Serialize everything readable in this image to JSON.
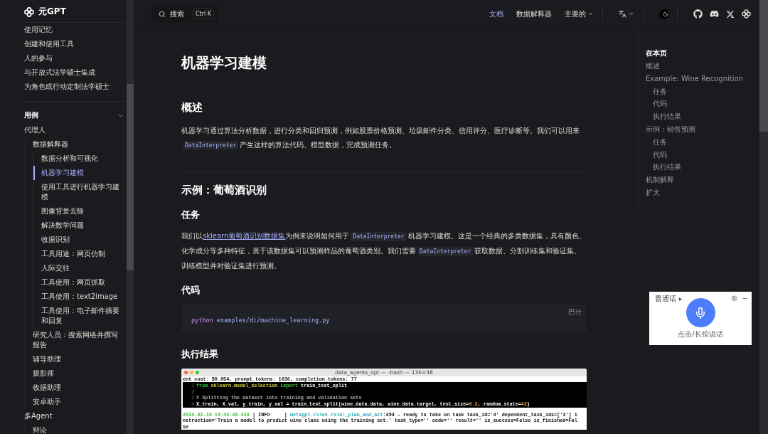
{
  "sidebar": {
    "logo_text": "元GPT",
    "items": [
      {
        "label": "使用记忆",
        "selected": false
      },
      {
        "label": "创建和使用工具",
        "selected": false
      },
      {
        "label": "人的参与",
        "selected": false
      },
      {
        "label": "与开放式法学硕士集成",
        "selected": false
      },
      {
        "label": "为角色或行动定制法学硕士",
        "selected": false
      }
    ],
    "sections": [
      {
        "title": "用例",
        "expanded": true,
        "children": [
          {
            "label": "代理人",
            "selected": false,
            "children": [
              {
                "label": "数据解释器",
                "selected": false,
                "children": [
                  {
                    "label": "数据分析和可视化",
                    "selected": false
                  },
                  {
                    "label": "机器学习建模",
                    "selected": true
                  },
                  {
                    "label": "使用工具进行机器学习建模",
                    "selected": false
                  },
                  {
                    "label": "图像背景去除",
                    "selected": false
                  },
                  {
                    "label": "解决数学问题",
                    "selected": false
                  },
                  {
                    "label": "收据识别",
                    "selected": false
                  },
                  {
                    "label": "工具用途：网页仿制",
                    "selected": false
                  },
                  {
                    "label": "人际交往",
                    "selected": false
                  },
                  {
                    "label": "工具使用：网页抓取",
                    "selected": false
                  },
                  {
                    "label": "工具使用：text2image",
                    "selected": false
                  },
                  {
                    "label": "工具使用：电子邮件摘要和回复",
                    "selected": false
                  }
                ]
              },
              {
                "label": "研究人员：搜索网络并撰写报告",
                "selected": false
              },
              {
                "label": "辅导助理",
                "selected": false
              },
              {
                "label": "摄影师",
                "selected": false
              },
              {
                "label": "收据助理",
                "selected": false
              },
              {
                "label": "安卓助手",
                "selected": false
              }
            ]
          },
          {
            "label": "多Agent",
            "selected": false,
            "children": [
              {
                "label": "辩论",
                "selected": false
              }
            ]
          }
        ]
      }
    ]
  },
  "topbar": {
    "search": {
      "placeholder": "搜索",
      "shortcut": "Ctrl K"
    },
    "nav": [
      {
        "label": "文档",
        "selected": true,
        "dropdown": false
      },
      {
        "label": "数据解释器",
        "selected": false,
        "dropdown": false
      },
      {
        "label": "主要的",
        "selected": false,
        "dropdown": true
      }
    ]
  },
  "article": {
    "title": "机器学习建模",
    "blocks": [
      {
        "kind": "h2",
        "text": "概述"
      },
      {
        "kind": "paragraph",
        "segments": [
          {
            "kind": "text",
            "text": "机器学习通过算法分析数据，进行分类和回归预测，例如股票价格预测、垃圾邮件分类、信用评分、医疗诊断等。我们可以用来"
          },
          {
            "kind": "code",
            "text": "DataInterpreter"
          },
          {
            "kind": "text",
            "text": "产生这样的算法代码、模型数据，完成预测任务。"
          }
        ]
      },
      {
        "kind": "rule"
      },
      {
        "kind": "h2",
        "text": "示例：葡萄酒识别"
      },
      {
        "kind": "h3",
        "text": "任务"
      },
      {
        "kind": "paragraph",
        "segments": [
          {
            "kind": "text",
            "text": "我们以"
          },
          {
            "kind": "link",
            "text": "sklearn葡萄酒识别数据集"
          },
          {
            "kind": "text",
            "text": "为例来说明如何用于"
          },
          {
            "kind": "code",
            "text": "DataInterpreter"
          },
          {
            "kind": "text",
            "text": "机器学习建模。这是一个经典的多类数据集，具有颜色、化学成分等多种特征，基于该数据集可以预测样品的葡萄酒类别。我们需要"
          },
          {
            "kind": "code",
            "text": "DataInterpreter"
          },
          {
            "kind": "text",
            "text": "获取数据、分割训练集和验证集、训练模型并对验证集进行预测。"
          }
        ]
      },
      {
        "kind": "h3",
        "text": "代码"
      },
      {
        "kind": "codeblock",
        "language": "巴什",
        "segments": [
          {
            "kind": "command",
            "text": "python"
          },
          {
            "kind": "plain",
            "text": " examples/di/machine_learning.py"
          }
        ]
      },
      {
        "kind": "h3",
        "text": "执行结果"
      },
      {
        "kind": "terminal",
        "title": "data_agents_opt — -bash — 136×38",
        "header": "ent cost: $0.054, prompt_tokens: 1636, completion_tokens: 77",
        "code_lines": [
          {
            "number": "1",
            "segments": [
              {
                "kind": "keyword",
                "text": "from"
              },
              {
                "kind": "module",
                "text": " sklearn.model_selection "
              },
              {
                "kind": "keyword",
                "text": "import"
              },
              {
                "kind": "plain",
                "text": " train_test_split"
              }
            ]
          },
          {
            "number": "2"
          },
          {
            "number": "3",
            "segments": [
              {
                "kind": "comment",
                "text": "# Splitting the dataset into training and validation sets"
              }
            ]
          },
          {
            "number": "4",
            "segments": [
              {
                "kind": "plain",
                "text": "X_train, X_val, y_train, y_val = train_test_split(wine_data.data, wine_data.target, test_size="
              },
              {
                "kind": "number",
                "text": "0.2"
              },
              {
                "kind": "plain",
                "text": ", random_state="
              },
              {
                "kind": "number",
                "text": "42"
              },
              {
                "kind": "plain",
                "text": ")"
              }
            ]
          }
        ],
        "log_lines": [
          {
            "segments": [
              {
                "kind": "time",
                "text": "2024-02-19 19:46:38.423"
              },
              {
                "kind": "plain",
                "text": " | INFO     | "
              },
              {
                "kind": "module",
                "text": "metagpt.roles.role"
              },
              {
                "kind": "plain",
                "text": ":"
              },
              {
                "kind": "module",
                "text": "_plan_and_act"
              },
              {
                "kind": "plain",
                "text": ":494 - ready to take on task task_id='4' dependent_task_ids=['3'] i"
              }
            ]
          },
          {
            "segments": [
              {
                "kind": "plain",
                "text": "nstruction='Train a model to predict wine class using the training set.' task_type='' code='' result='' is_success=False is_finished=Fal"
              }
            ]
          },
          {
            "segments": [
              {
                "kind": "plain",
                "text": "se"
              }
            ]
          }
        ]
      }
    ]
  },
  "toc": {
    "title": "在本页",
    "items": [
      {
        "label": "概述"
      },
      {
        "label": "Example: Wine Recognition",
        "children": [
          {
            "label": "任务"
          },
          {
            "label": "代码"
          },
          {
            "label": "执行结果"
          }
        ]
      },
      {
        "label": "示例：销售预测",
        "children": [
          {
            "label": "任务"
          },
          {
            "label": "代码"
          },
          {
            "label": "执行结果"
          }
        ]
      },
      {
        "label": "机制解释"
      },
      {
        "label": "扩大"
      }
    ]
  },
  "voice_widget": {
    "language": "普通话",
    "hint": "点击/长按说话"
  }
}
